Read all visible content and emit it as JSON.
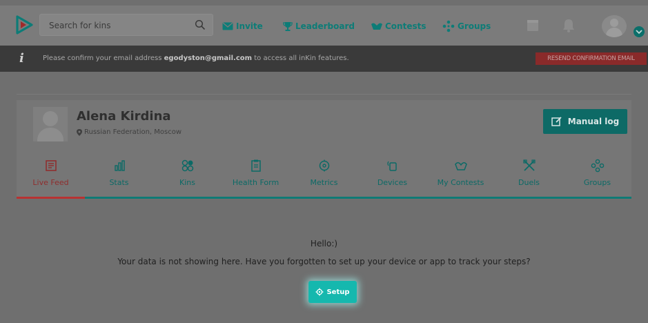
{
  "header": {
    "search_placeholder": "Search for kins",
    "nav": [
      {
        "label": "Invite",
        "icon": "mail-icon"
      },
      {
        "label": "Leaderboard",
        "icon": "trophy-icon"
      },
      {
        "label": "Contests",
        "icon": "contest-icon"
      },
      {
        "label": "Groups",
        "icon": "groups-icon"
      }
    ],
    "utility_icons": [
      "calendar-icon",
      "bell-icon"
    ]
  },
  "notice": {
    "info_glyph": "i",
    "prefix": "Please confirm your email address ",
    "email": "egodyston@gmail.com",
    "suffix": " to access all inKin features.",
    "button": "RESEND CONFIRMATION EMAIL"
  },
  "profile": {
    "name": "Alena Kirdina",
    "location": "Russian Federation, Moscow",
    "manual_log": "Manual log"
  },
  "tabs": [
    {
      "label": "Live Feed",
      "icon": "live-feed-icon",
      "active": true
    },
    {
      "label": "Stats",
      "icon": "stats-icon",
      "active": false
    },
    {
      "label": "Kins",
      "icon": "kins-icon",
      "active": false
    },
    {
      "label": "Health Form",
      "icon": "health-form-icon",
      "active": false
    },
    {
      "label": "Metrics",
      "icon": "metrics-icon",
      "active": false
    },
    {
      "label": "Devices",
      "icon": "devices-icon",
      "active": false
    },
    {
      "label": "My Contests",
      "icon": "my-contests-icon",
      "active": false
    },
    {
      "label": "Duels",
      "icon": "duels-icon",
      "active": false
    },
    {
      "label": "Groups",
      "icon": "groups-icon",
      "active": false
    }
  ],
  "empty_state": {
    "greeting": "Hello:)",
    "message": "Your data is not showing here. Have you forgotten to set up your device or app to track your steps?",
    "button": "Setup"
  },
  "colors": {
    "accent": "#0f7a75",
    "active_tab": "#b83232",
    "setup_button": "#15b8ae"
  }
}
